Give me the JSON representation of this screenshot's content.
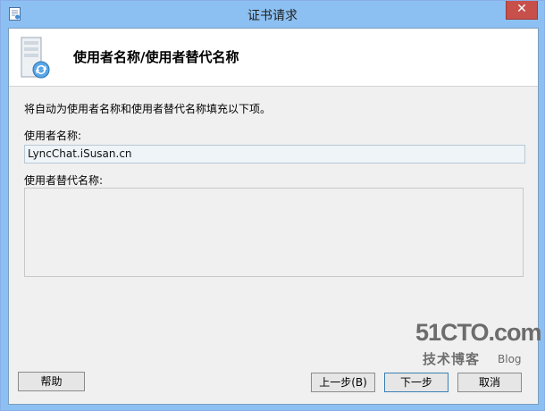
{
  "window": {
    "title": "证书请求",
    "close_label": "✕"
  },
  "header": {
    "title": "使用者名称/使用者替代名称"
  },
  "main": {
    "intro": "将自动为使用者名称和使用者替代名称填充以下项。",
    "subject_label": "使用者名称:",
    "subject_value": "LyncChat.iSusan.cn",
    "alt_names_label": "使用者替代名称:"
  },
  "buttons": {
    "help": "帮助",
    "back": "上一步(B)",
    "next": "下一步",
    "cancel": "取消"
  },
  "watermark": {
    "site": "51CTO.com",
    "caption": "技术博客",
    "blog": "Blog"
  },
  "colors": {
    "titlebar": "#8cc0f3",
    "close_button": "#c7504b",
    "panel": "#f0f0f0"
  }
}
